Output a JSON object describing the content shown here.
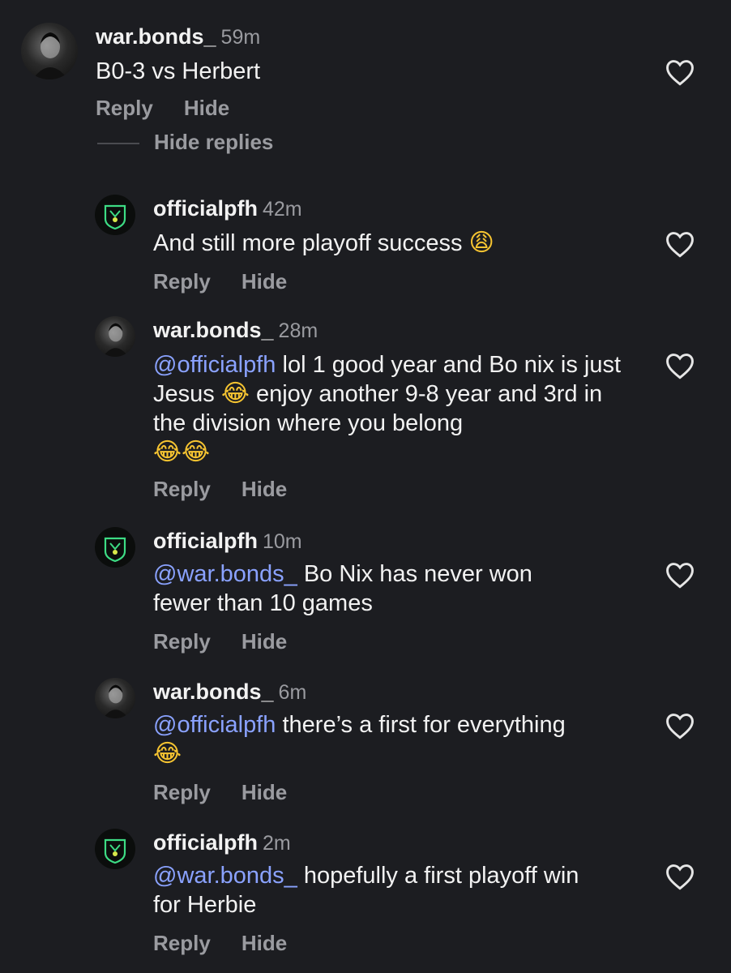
{
  "comments": [
    {
      "username": "war.bonds_",
      "time": "59m",
      "text": "B0-3 vs Herbert",
      "reply": "Reply",
      "hide": "Hide"
    },
    {
      "username": "officialpfh",
      "time": "42m",
      "text": "And still more playoff success",
      "emoji": "😩",
      "reply": "Reply",
      "hide": "Hide"
    },
    {
      "username": "war.bonds_",
      "time": "28m",
      "mention": "@officialpfh",
      "text_1": " lol 1 good year and Bo nix is just Jesus ",
      "emoji_1": "😂",
      "text_2": " enjoy another 9-8 year and 3rd in the division where you belong",
      "emoji_2": "😂😂",
      "reply": "Reply",
      "hide": "Hide"
    },
    {
      "username": "officialpfh",
      "time": "10m",
      "mention": "@war.bonds_",
      "text": " Bo Nix has never won fewer than 10 games",
      "reply": "Reply",
      "hide": "Hide"
    },
    {
      "username": "war.bonds_",
      "time": "6m",
      "mention": "@officialpfh",
      "text": " there’s a first for everything",
      "emoji": "😂",
      "reply": "Reply",
      "hide": "Hide"
    },
    {
      "username": "officialpfh",
      "time": "2m",
      "mention": "@war.bonds_",
      "text": " hopefully a first playoff win for Herbie",
      "reply": "Reply",
      "hide": "Hide"
    }
  ],
  "hide_replies": "Hide replies",
  "icons": {
    "like": "heart-outline-icon",
    "brand_avatar": "shield-logo-icon"
  },
  "colors": {
    "background": "#1c1d21",
    "mention": "#8aa2ff",
    "muted": "#9a9ba0"
  }
}
